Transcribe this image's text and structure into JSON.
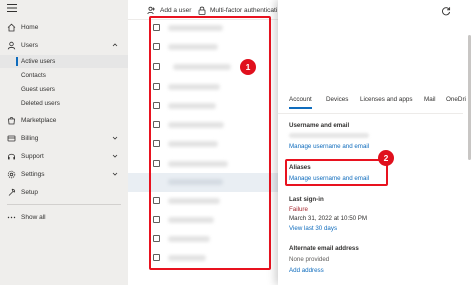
{
  "nav": {
    "home": "Home",
    "users": "Users",
    "active_users": "Active users",
    "contacts": "Contacts",
    "guest_users": "Guest users",
    "deleted_users": "Deleted users",
    "marketplace": "Marketplace",
    "billing": "Billing",
    "support": "Support",
    "settings": "Settings",
    "setup": "Setup",
    "show_all": "Show all"
  },
  "toolbar": {
    "add_user": "Add a user",
    "mfa": "Multi-factor authenticati"
  },
  "list": {
    "row_count": 12,
    "highlighted_row": 7
  },
  "markers": {
    "one": "1",
    "two": "2"
  },
  "panel": {
    "tabs": [
      "Account",
      "Devices",
      "Licenses and apps",
      "Mail",
      "OneDri"
    ],
    "username_email_heading": "Username and email",
    "manage_username_1": "Manage username and email",
    "aliases_heading": "Aliases",
    "manage_username_2": "Manage username and email",
    "last_signin_heading": "Last sign-in",
    "last_signin_status": "Failure",
    "last_signin_date": "March 31, 2022 at 10:50 PM",
    "view_last_30": "View last 30 days",
    "alt_email_heading": "Alternate email address",
    "alt_email_value": "None provided",
    "add_address": "Add address"
  },
  "colors": {
    "accent": "#0f6cbd",
    "highlight_red": "#e8121f",
    "nav_bg": "#efeeec",
    "failure": "#a4262c"
  },
  "icons": [
    "menu-icon",
    "home-icon",
    "user-icon",
    "marketplace-icon",
    "billing-icon",
    "support-icon",
    "settings-icon",
    "setup-icon",
    "more-icon",
    "add-user-icon",
    "lock-icon",
    "refresh-icon",
    "chevron-down-icon",
    "chevron-up-icon"
  ]
}
